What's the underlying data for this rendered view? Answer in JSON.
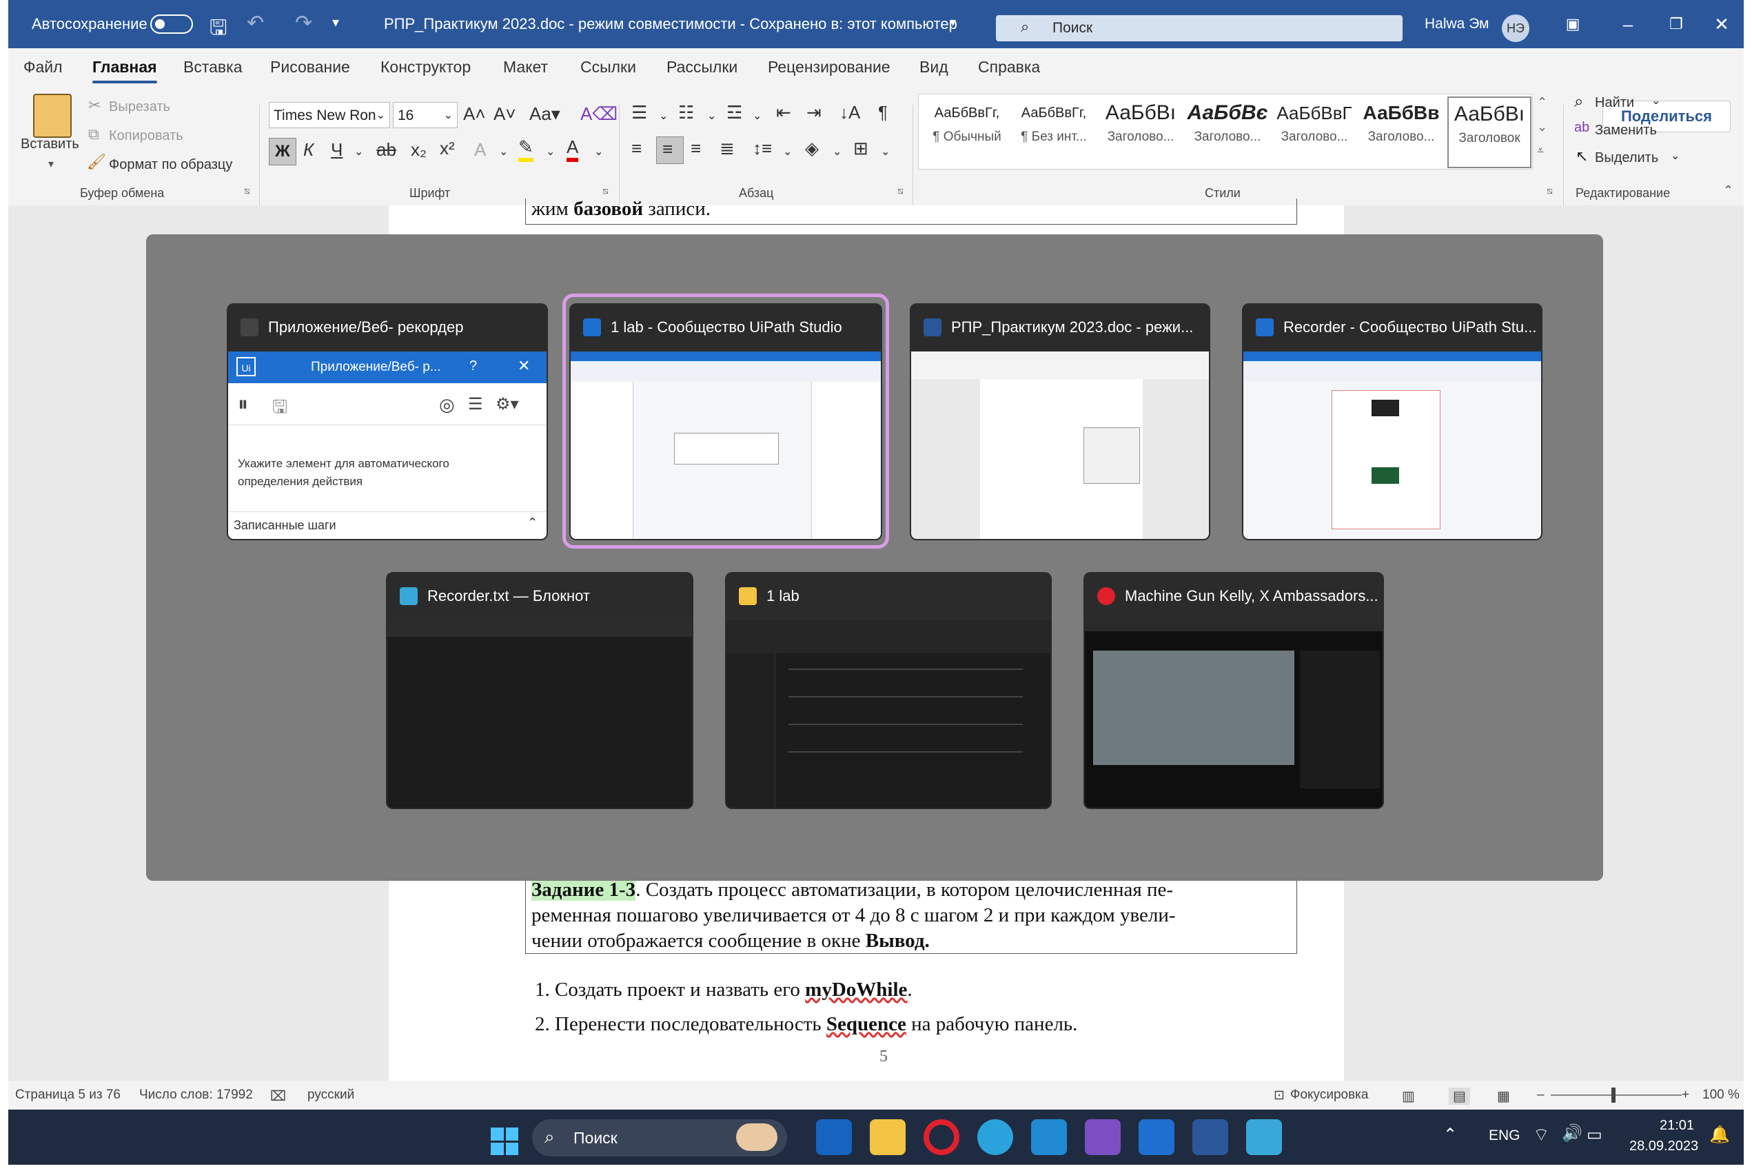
{
  "titlebar": {
    "autosave_label": "Автосохранение",
    "doc_title": "РПР_Практикум 2023.doc  -  режим совместимости  -  Сохранено в: этот компьютер",
    "search_placeholder": "Поиск",
    "user_name": "Halwa Эм",
    "user_initials": "НЭ"
  },
  "ribbon": {
    "tabs": [
      "Файл",
      "Главная",
      "Вставка",
      "Рисование",
      "Конструктор",
      "Макет",
      "Ссылки",
      "Рассылки",
      "Рецензирование",
      "Вид",
      "Справка"
    ],
    "active_tab": "Главная",
    "share_label": "Поделиться",
    "clipboard": {
      "paste": "Вставить",
      "cut": "Вырезать",
      "copy": "Копировать",
      "format_painter": "Формат по образцу",
      "group": "Буфер обмена"
    },
    "font": {
      "family": "Times New Ron",
      "size": "16",
      "group": "Шрифт",
      "bold": "Ж",
      "italic": "К",
      "underline": "Ч"
    },
    "paragraph": {
      "group": "Абзац"
    },
    "styles": {
      "group": "Стили",
      "items": [
        {
          "preview": "АаБбВвГг,",
          "name": "¶ Обычный"
        },
        {
          "preview": "АаБбВвГг,",
          "name": "¶ Без инт..."
        },
        {
          "preview": "АаБбВı",
          "name": "Заголово..."
        },
        {
          "preview": "АаБбВє",
          "name": "Заголово..."
        },
        {
          "preview": "АаБбВвГ",
          "name": "Заголово..."
        },
        {
          "preview": "АаБбВв",
          "name": "Заголово..."
        },
        {
          "preview": "АаБбВı",
          "name": "Заголовок"
        }
      ]
    },
    "editing": {
      "group": "Редактирование",
      "find": "Найти",
      "replace": "Заменить",
      "select": "Выделить"
    }
  },
  "document": {
    "top_line_a": "жим ",
    "top_line_bold": "базовой",
    "top_line_b": " записи.",
    "task_label": "Задание 1-3",
    "task_lines": [
      ". Создать процесс автоматизации, в котором целочисленная пе-",
      "ременная пошагово увеличивается от 4 до 8 с шагом 2 и при каждом увели-",
      "чении отображается сообщение в окне "
    ],
    "task_bold_end": "Вывод.",
    "step1_a": "1. Создать проект и назвать его ",
    "step1_bold": "myDoWhile",
    "step1_b": ".",
    "step2_a": "2. Перенести последовательность ",
    "step2_bold": "Sequence",
    "step2_b": " на рабочую панель.",
    "page_number": "5"
  },
  "task_switcher": {
    "windows": [
      {
        "title": "Приложение/Веб- рекордер",
        "app": "recorder"
      },
      {
        "title": "1 lab - Сообщество UiPath Studio",
        "app": "uipath",
        "selected": true
      },
      {
        "title": "РПР_Практикум 2023.doc  -  режи...",
        "app": "word"
      },
      {
        "title": "Recorder - Сообщество UiPath Stu...",
        "app": "uipath"
      },
      {
        "title": "Recorder.txt — Блокнот",
        "app": "notepad"
      },
      {
        "title": "1 lab",
        "app": "explorer"
      },
      {
        "title": "Machine Gun Kelly, X Ambassadors...",
        "app": "opera"
      }
    ],
    "recorder_panel": {
      "title": "Приложение/Веб- р...",
      "help": "?",
      "hint": "Укажите элемент для автоматического определения действия",
      "steps": "Записанные шаги"
    }
  },
  "statusbar": {
    "page": "Страница 5 из 76",
    "words": "Число слов: 17992",
    "language": "русский",
    "focus": "Фокусировка",
    "zoom": "100 %"
  },
  "taskbar": {
    "search": "Поиск",
    "lang": "ENG",
    "time": "21:01",
    "date": "28.09.2023"
  },
  "colors": {
    "word_blue": "#2b579a",
    "taskbar": "#1f2b40",
    "selection": "#d79ee6",
    "highlight": "#c6efc0"
  }
}
